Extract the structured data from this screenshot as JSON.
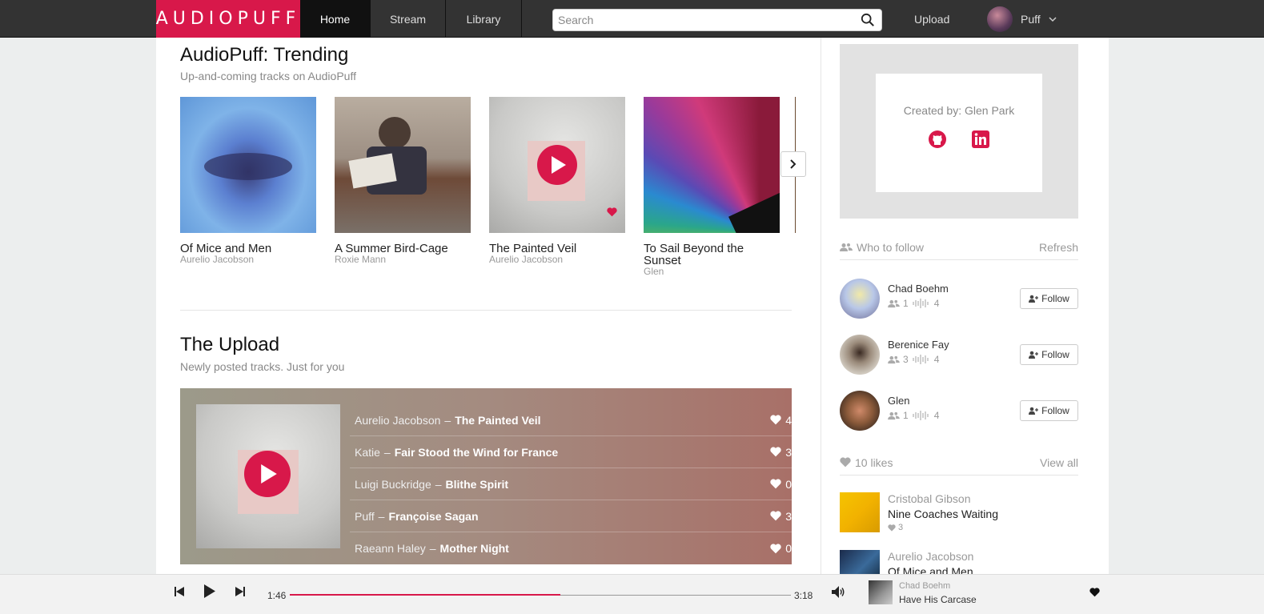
{
  "header": {
    "logo": "AUDIOPUFF",
    "tabs": [
      "Home",
      "Stream",
      "Library"
    ],
    "search_placeholder": "Search",
    "upload": "Upload",
    "username": "Puff"
  },
  "trending": {
    "title": "AudioPuff: Trending",
    "subtitle": "Up-and-coming tracks on AudioPuff",
    "tiles": [
      {
        "title": "Of Mice and Men",
        "artist": "Aurelio Jacobson"
      },
      {
        "title": "A Summer Bird-Cage",
        "artist": "Roxie Mann"
      },
      {
        "title": "The Painted Veil",
        "artist": "Aurelio Jacobson"
      },
      {
        "title": "To Sail Beyond the Sunset",
        "artist": "Glen"
      }
    ]
  },
  "upload_section": {
    "title": "The Upload",
    "subtitle": "Newly posted tracks. Just for you",
    "tracks": [
      {
        "artist": "Aurelio Jacobson",
        "title": "The Painted Veil",
        "likes": "4"
      },
      {
        "artist": "Katie",
        "title": "Fair Stood the Wind for France",
        "likes": "3"
      },
      {
        "artist": "Luigi Buckridge",
        "title": "Blithe Spirit",
        "likes": "0"
      },
      {
        "artist": "Puff",
        "title": "Françoise Sagan",
        "likes": "3"
      },
      {
        "artist": "Raeann Haley",
        "title": "Mother Night",
        "likes": "0"
      }
    ]
  },
  "sidebar": {
    "credit": "Created by: Glen Park",
    "who_to_follow": "Who to follow",
    "refresh": "Refresh",
    "follow_label": "Follow",
    "suggestions": [
      {
        "name": "Chad Boehm",
        "followers": "1",
        "tracks": "4"
      },
      {
        "name": "Berenice Fay",
        "followers": "3",
        "tracks": "4"
      },
      {
        "name": "Glen",
        "followers": "1",
        "tracks": "4"
      }
    ],
    "likes_header": "10 likes",
    "view_all": "View all",
    "likes": [
      {
        "artist": "Cristobal Gibson",
        "title": "Nine Coaches Waiting",
        "likes": "3"
      },
      {
        "artist": "Aurelio Jacobson",
        "title": "Of Mice and Men",
        "likes": ""
      }
    ]
  },
  "player": {
    "current_time": "1:46",
    "total_time": "3:18",
    "progress": 0.54,
    "artist": "Chad Boehm",
    "title": "Have His Carcase"
  },
  "colors": {
    "accent": "#d8184a",
    "nav_bg": "#333333"
  }
}
